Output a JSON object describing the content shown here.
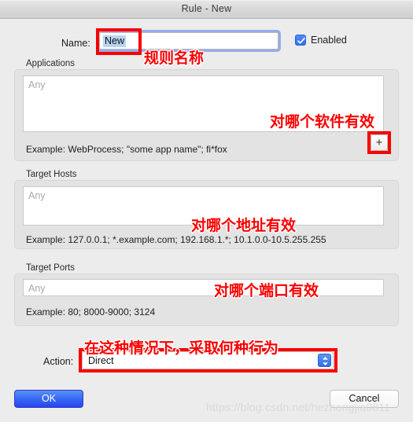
{
  "window": {
    "title": "Rule - New"
  },
  "form": {
    "name_label": "Name:",
    "name_value": "New",
    "enabled_label": "Enabled",
    "enabled_checked": true,
    "applications": {
      "title": "Applications",
      "placeholder": "Any",
      "value": "",
      "example": "Example: WebProcess; \"some app name\"; fi*fox",
      "add_button": "+"
    },
    "target_hosts": {
      "title": "Target Hosts",
      "placeholder": "Any",
      "value": "",
      "example": "Example: 127.0.0.1; *.example.com; 192.168.1.*; 10.1.0.0-10.5.255.255"
    },
    "target_ports": {
      "title": "Target Ports",
      "placeholder": "Any",
      "value": "",
      "example": "Example: 80; 8000-9000; 3124"
    },
    "action": {
      "label": "Action:",
      "selected": "Direct"
    }
  },
  "footer": {
    "ok_label": "OK",
    "cancel_label": "Cancel"
  },
  "annotations": {
    "name": "规则名称",
    "applications": "对哪个软件有效",
    "hosts": "对哪个地址有效",
    "ports": "对哪个端口有效",
    "action": "在这种情况下，采取何种行为",
    "color": "#fb0000"
  },
  "watermark": {
    "text": "https://blog.csdn.net/hezhongjia0811"
  }
}
